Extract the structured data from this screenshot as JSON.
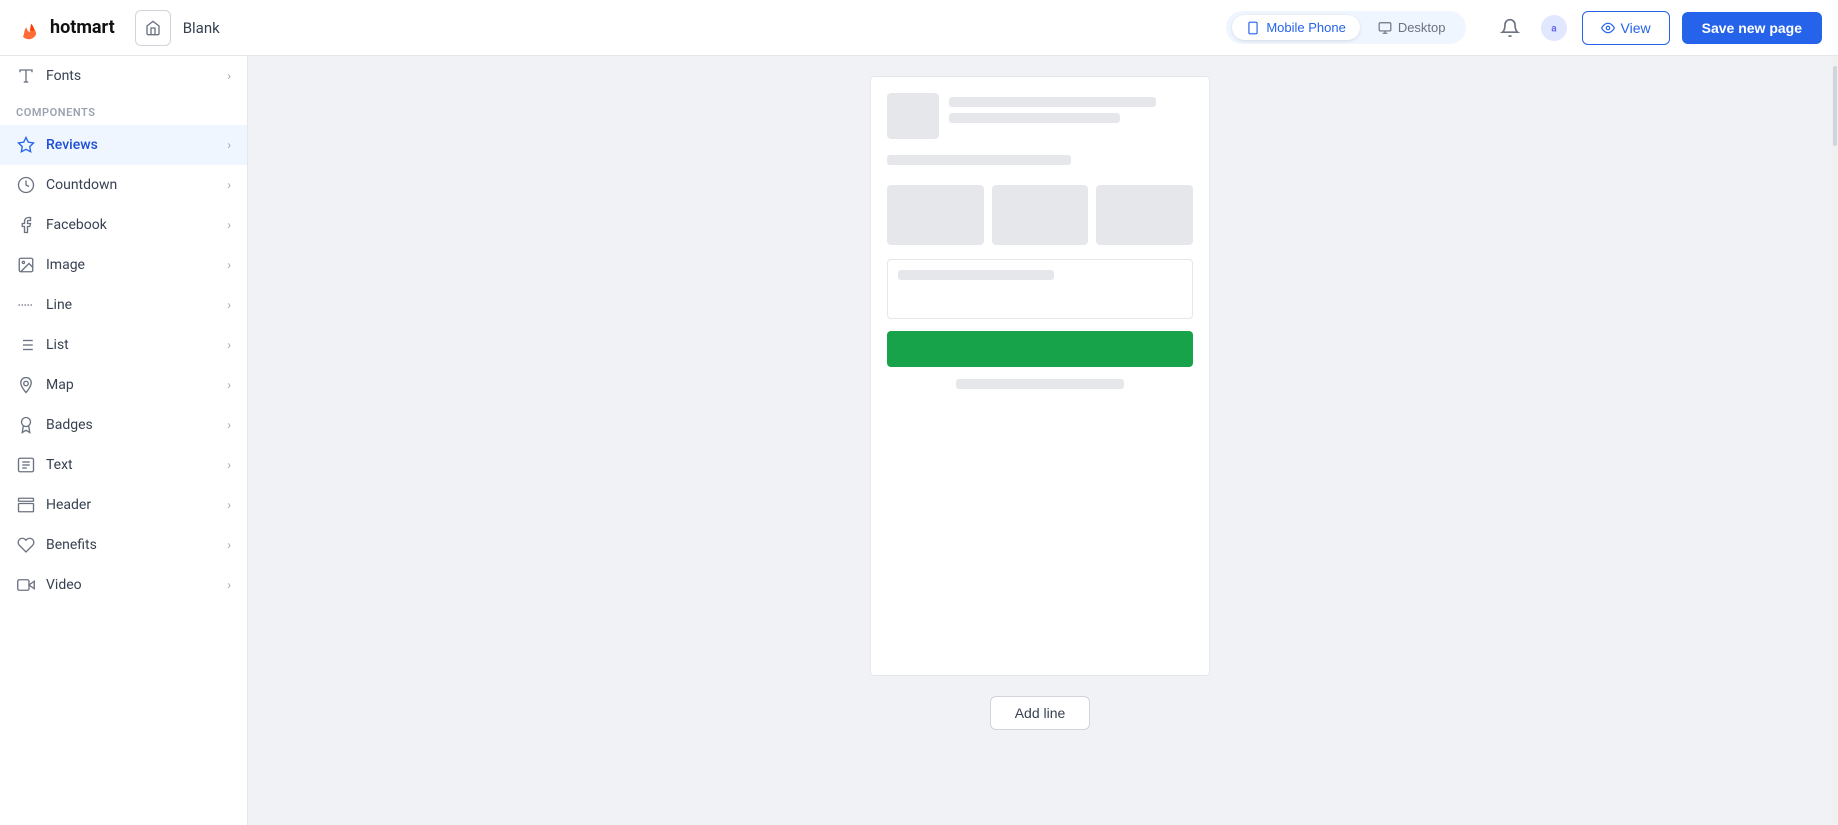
{
  "app": {
    "logo_text": "hotmart",
    "page_title": "Blank"
  },
  "topbar": {
    "home_label": "home",
    "mobile_phone_label": "Mobile Phone",
    "desktop_label": "Desktop",
    "view_label": "View",
    "save_label": "Save new page",
    "active_view": "mobile"
  },
  "sidebar": {
    "fonts_label": "Fonts",
    "components_label": "COMPONENTS",
    "items": [
      {
        "id": "reviews",
        "label": "Reviews",
        "icon": "star",
        "active": true
      },
      {
        "id": "countdown",
        "label": "Countdown",
        "icon": "clock",
        "active": false
      },
      {
        "id": "facebook",
        "label": "Facebook",
        "icon": "facebook",
        "active": false
      },
      {
        "id": "image",
        "label": "Image",
        "icon": "image",
        "active": false
      },
      {
        "id": "line",
        "label": "Line",
        "icon": "line",
        "active": false
      },
      {
        "id": "list",
        "label": "List",
        "icon": "list",
        "active": false
      },
      {
        "id": "map",
        "label": "Map",
        "icon": "map",
        "active": false
      },
      {
        "id": "badges",
        "label": "Badges",
        "icon": "badges",
        "active": false
      },
      {
        "id": "text",
        "label": "Text",
        "icon": "text",
        "active": false
      },
      {
        "id": "header",
        "label": "Header",
        "icon": "header",
        "active": false
      },
      {
        "id": "benefits",
        "label": "Benefits",
        "icon": "benefits",
        "active": false
      },
      {
        "id": "video",
        "label": "Video",
        "icon": "video",
        "active": false
      }
    ]
  },
  "canvas": {
    "add_line_label": "Add line"
  }
}
